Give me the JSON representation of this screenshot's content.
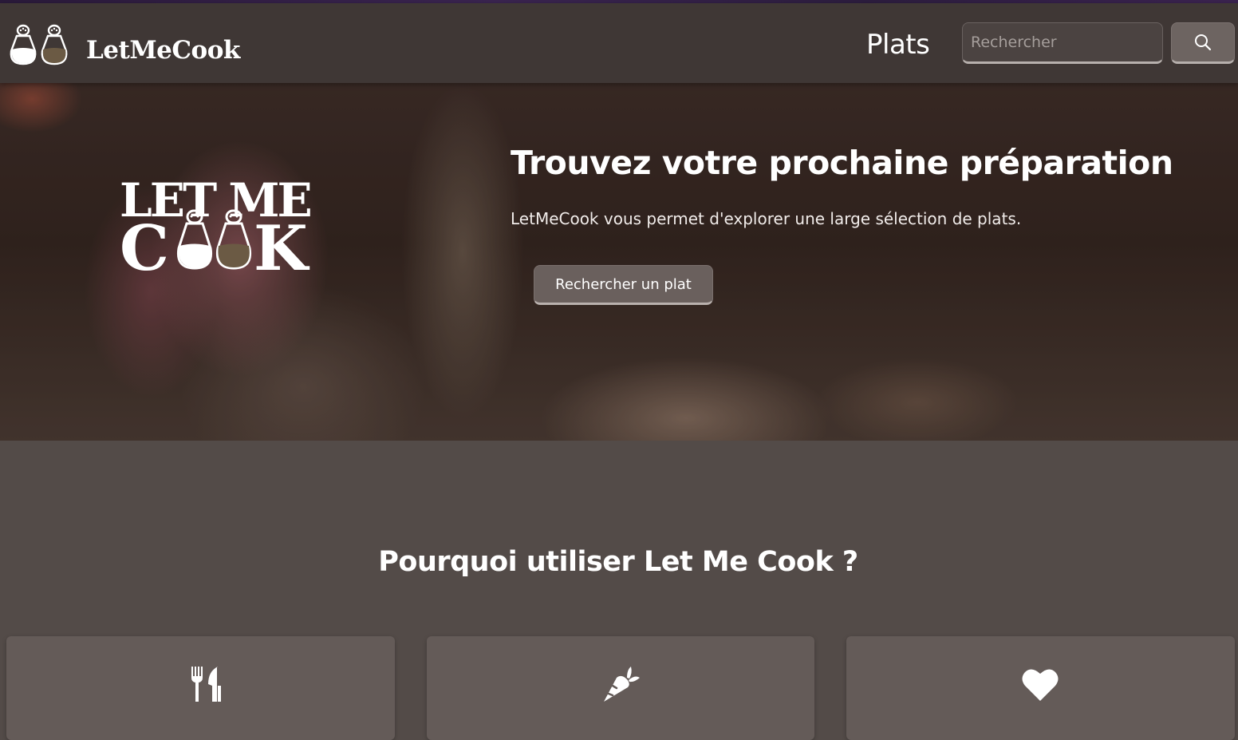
{
  "navbar": {
    "brand_name": "LetMeCook",
    "nav_link": "Plats",
    "search": {
      "placeholder": "Rechercher",
      "value": ""
    },
    "search_button_icon": "search-icon"
  },
  "hero": {
    "logo_text": "LET ME COOK",
    "title": "Trouvez votre prochaine préparation",
    "subtitle": "LetMeCook vous permet d'explorer une large sélection de plats.",
    "button_label": "Rechercher un plat"
  },
  "features": {
    "title": "Pourquoi utiliser Let Me Cook ?",
    "cards": [
      {
        "icon": "utensils-icon"
      },
      {
        "icon": "carrot-icon"
      },
      {
        "icon": "heart-icon"
      }
    ]
  },
  "colors": {
    "navbar_bg": "#3f3735",
    "page_bg": "#534b48",
    "card_bg": "#645b58",
    "button_bg": "#6a605d",
    "text": "#ffffff",
    "pepper_fill": "#6b5a44"
  }
}
